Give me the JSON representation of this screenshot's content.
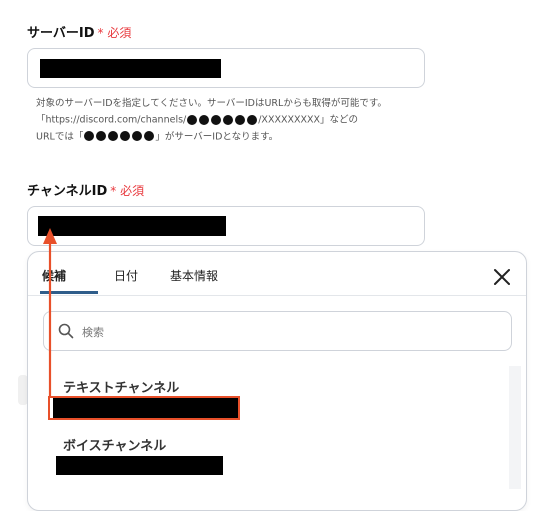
{
  "server_id": {
    "label": "サーバーID",
    "required": "* 必須"
  },
  "help_text": {
    "line1": "対象のサーバーIDを指定してください。サーバーIDはURLからも取得が可能です。",
    "line2_prefix": "「https://discord.com/channels/",
    "line2_suffix": "/XXXXXXXXX」などの",
    "line3_prefix": "URLでは「",
    "line3_suffix": "」がサーバーIDとなります。"
  },
  "channel_id": {
    "label": "チャンネルID",
    "required": "* 必須"
  },
  "dropdown": {
    "tabs": [
      "候補",
      "日付",
      "基本情報"
    ],
    "search_placeholder": "検索",
    "groups": [
      "テキストチャンネル",
      "ボイスチャンネル"
    ]
  },
  "colors": {
    "required": "#e8383d",
    "annotation": "#e8502a",
    "tab_active_underline": "#2f5d8a"
  }
}
